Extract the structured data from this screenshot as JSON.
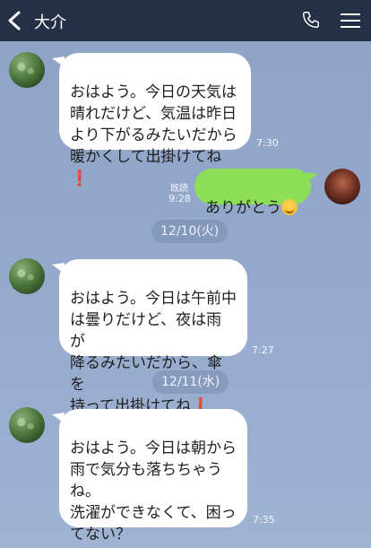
{
  "header": {
    "title": "大介",
    "icons": [
      "back-chevron-icon",
      "phone-icon",
      "menu-icon"
    ],
    "background": "#243045"
  },
  "messages": [
    {
      "side": "left",
      "text": "おはよう。今日の天気は\n晴れだけど、気温は昨日\nより下がるみたいだから\n暖かくして出掛けてね",
      "emoji": "❗",
      "time": "7:30"
    },
    {
      "side": "right",
      "text": "ありがとう",
      "emoji": "😊",
      "read_label": "既読",
      "time": "9:28"
    },
    {
      "date": "12/10(火)"
    },
    {
      "side": "left",
      "text": "おはよう。今日は午前中\nは曇りだけど、夜は雨が\n降るみたいだから、傘を\n持って出掛けてね",
      "emoji": "❗",
      "time": "7:27"
    },
    {
      "date": "12/11(水)"
    },
    {
      "side": "left",
      "text": "おはよう。今日は朝から\n雨で気分も落ちちゃう\nね。\n洗濯ができなくて、困っ\nてない？",
      "time": "7:35"
    }
  ],
  "colors": {
    "bubble_self": "#8de055",
    "bubble_other": "#ffffff",
    "exclaim": "#d8242c"
  }
}
